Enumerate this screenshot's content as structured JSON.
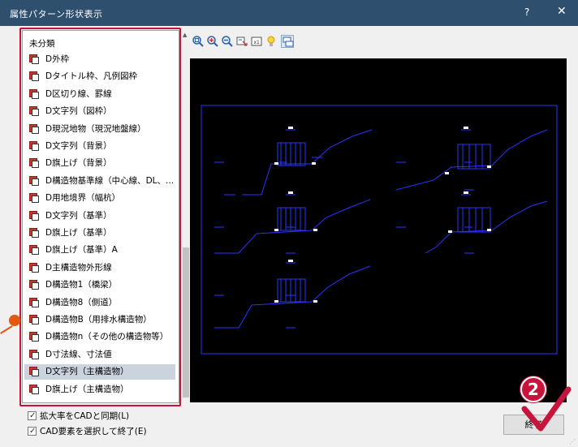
{
  "window": {
    "title": "属性パターン形状表示",
    "help_label": "?",
    "close_label": "✕"
  },
  "layer_list": {
    "header": "未分類",
    "items": [
      {
        "label": "D外枠"
      },
      {
        "label": "Dタイトル枠、凡例図枠"
      },
      {
        "label": "D区切り線、罫線"
      },
      {
        "label": "D文字列（図枠）"
      },
      {
        "label": "D現況地物（現況地盤線）"
      },
      {
        "label": "D文字列（背景）"
      },
      {
        "label": "D旗上げ（背景）"
      },
      {
        "label": "D構造物基準線（中心線、DL、..."
      },
      {
        "label": "D用地境界（幅杭）"
      },
      {
        "label": "D文字列（基準）"
      },
      {
        "label": "D旗上げ（基準）"
      },
      {
        "label": "D旗上げ（基準）A"
      },
      {
        "label": "D主構造物外形線"
      },
      {
        "label": "D構造物1（橋梁）"
      },
      {
        "label": "D構造物8（側道）"
      },
      {
        "label": "D構造物B（用排水構造物）"
      },
      {
        "label": "D構造物n（その他の構造物等）"
      },
      {
        "label": "D寸法線、寸法値"
      },
      {
        "label": "D文字列（主構造物）",
        "selected": true
      },
      {
        "label": "D旗上げ（主構造物）"
      }
    ]
  },
  "toolbar": {
    "buttons": [
      {
        "icon": "zoom-fit-icon"
      },
      {
        "icon": "zoom-in-icon"
      },
      {
        "icon": "zoom-out-icon"
      },
      {
        "icon": "pan-icon"
      },
      {
        "icon": "scale-1x-icon"
      },
      {
        "icon": "light-bulb-icon"
      },
      {
        "icon": "layer-icon"
      }
    ]
  },
  "options": {
    "sync_zoom_label": "拡大率をCADと同期(L)",
    "sync_zoom_checked": true,
    "select_and_exit_label": "CAD要素を選択して終了(E)",
    "select_and_exit_checked": true
  },
  "end_button_label": "終了",
  "annotation": {
    "step_number": "2"
  },
  "colors": {
    "titlebar": "#2f4f6f",
    "highlight_frame": "#c8143c",
    "selected_row": "#cbd3de",
    "preview_bg": "#000000",
    "drawing_lines": "#1e28ff"
  }
}
